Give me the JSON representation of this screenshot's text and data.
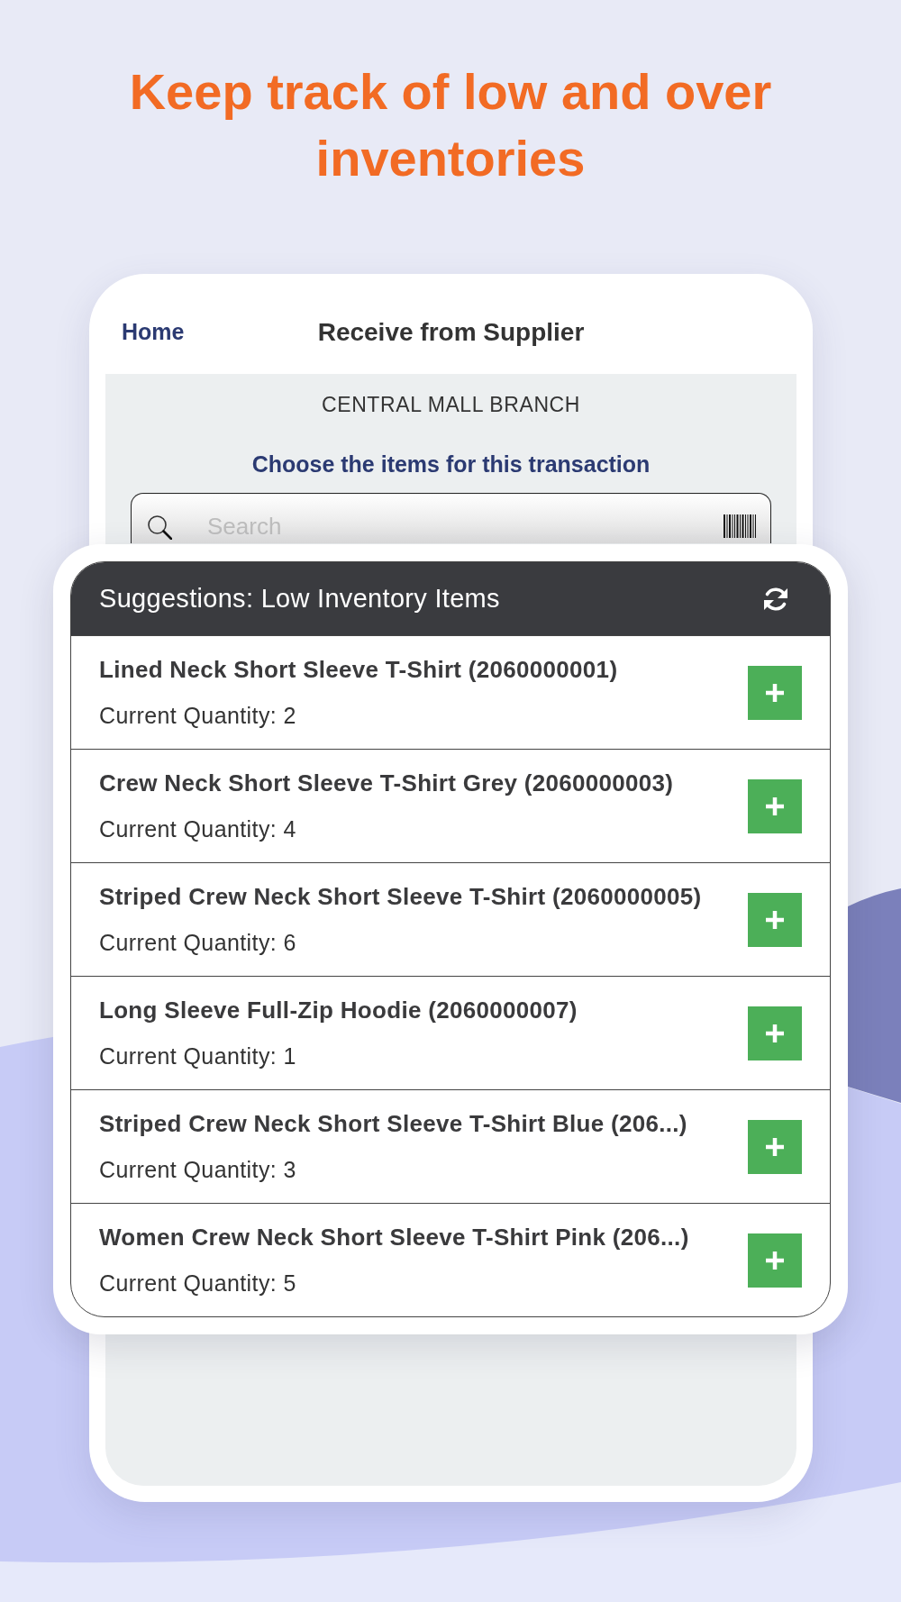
{
  "headline": "Keep track of low and over inventories",
  "nav": {
    "back": "Home",
    "title": "Receive from Supplier"
  },
  "branch": "CENTRAL MALL BRANCH",
  "instruction": "Choose the items for this transaction",
  "search": {
    "placeholder": "Search"
  },
  "suggestions": {
    "title": "Suggestions: Low Inventory Items",
    "items": [
      {
        "name": "Lined Neck Short Sleeve T-Shirt (2060000001)",
        "quantity": "Current Quantity: 2"
      },
      {
        "name": "Crew Neck Short Sleeve T-Shirt Grey (2060000003)",
        "quantity": "Current Quantity: 4"
      },
      {
        "name": "Striped Crew Neck Short Sleeve T-Shirt (2060000005)",
        "quantity": "Current Quantity: 6"
      },
      {
        "name": "Long Sleeve Full-Zip Hoodie (2060000007)",
        "quantity": "Current Quantity: 1"
      },
      {
        "name": "Striped Crew Neck Short Sleeve T-Shirt Blue (206...)",
        "quantity": "Current Quantity: 3"
      },
      {
        "name": "Women Crew Neck Short Sleeve T-Shirt Pink (206...)",
        "quantity": "Current Quantity: 5"
      }
    ]
  }
}
